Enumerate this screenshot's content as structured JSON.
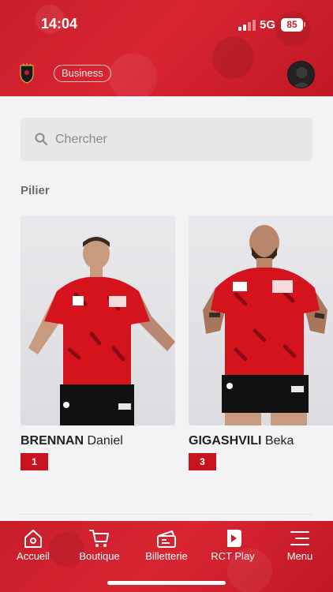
{
  "status_bar": {
    "time": "14:04",
    "network": "5G",
    "battery": "85"
  },
  "header": {
    "business_label": "Business"
  },
  "search": {
    "placeholder": "Chercher"
  },
  "section": {
    "title": "Pilier"
  },
  "players": [
    {
      "last_name": "BRENNAN",
      "first_name": "Daniel",
      "number": "1"
    },
    {
      "last_name": "GIGASHVILI",
      "first_name": "Beka",
      "number": "3"
    }
  ],
  "bottom_nav": [
    {
      "label": "Accueil",
      "icon": "home-icon"
    },
    {
      "label": "Boutique",
      "icon": "cart-icon"
    },
    {
      "label": "Billetterie",
      "icon": "ticket-icon"
    },
    {
      "label": "RCT Play",
      "icon": "play-icon"
    },
    {
      "label": "Menu",
      "icon": "menu-icon"
    }
  ],
  "colors": {
    "brand_red": "#c81e2a",
    "number_badge": "#c8141f",
    "background": "#f3f3f5"
  }
}
